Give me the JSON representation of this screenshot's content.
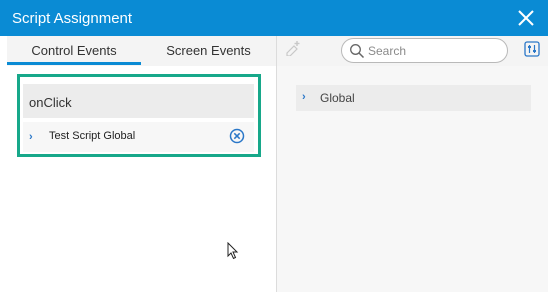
{
  "dialog": {
    "title": "Script Assignment",
    "close_icon": "close-icon",
    "accent": "#0a8bd4",
    "highlight_color": "#17a88a"
  },
  "left": {
    "tabs": [
      {
        "label": "Control Events",
        "selected": true
      },
      {
        "label": "Screen Events",
        "selected": false
      }
    ],
    "event": {
      "label": "onClick",
      "scripts": [
        {
          "label": "Test Script Global",
          "expand_icon": "chevron-right-icon",
          "remove_icon": "remove-circle-icon"
        }
      ]
    }
  },
  "right": {
    "add_icon": "add-script-icon",
    "search": {
      "placeholder": "Search",
      "value": "",
      "icon": "search-icon"
    },
    "settings_icon": "settings-icon",
    "tree": [
      {
        "label": "Global",
        "expand_icon": "chevron-right-icon"
      }
    ]
  }
}
